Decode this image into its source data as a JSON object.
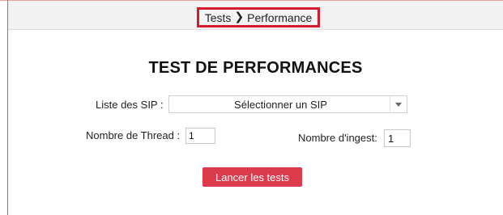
{
  "breadcrumb": {
    "root": "Tests",
    "current": "Performance"
  },
  "page": {
    "title": "TEST DE PERFORMANCES"
  },
  "form": {
    "sip_label": "Liste des SIP :",
    "sip_select_value": "Sélectionner un SIP",
    "thread_label": "Nombre de Thread :",
    "thread_value": "1",
    "ingest_label": "Nombre d'ingest:",
    "ingest_value": "1",
    "submit_label": "Lancer les tests"
  },
  "colors": {
    "accent": "#dc3b4b",
    "highlight_border": "#d41a2c",
    "header_bg": "#f2f2f2"
  },
  "icons": {
    "breadcrumb_separator": "chevron-right-icon",
    "select_caret": "caret-down-icon"
  }
}
